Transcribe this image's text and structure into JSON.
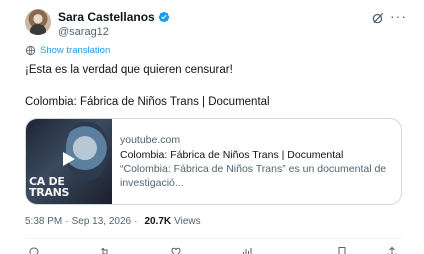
{
  "author": {
    "display_name": "Sara Castellanos",
    "handle": "@sarag12",
    "verified_color": "#1d9bf0"
  },
  "header_icons": [
    "grok-icon",
    "more-icon"
  ],
  "more_glyph": "···",
  "translate": {
    "label": "Show translation",
    "icon": "globe-icon"
  },
  "tweet": {
    "line1": "¡Esta es la verdad que quieren censurar!",
    "line2": "Colombia: Fábrica de Niños Trans | Documental"
  },
  "card": {
    "thumbnail_title": "CA DE TRANS",
    "thumbnail_title_line1": "CA DE",
    "thumbnail_title_line2": "TRANS",
    "domain": "youtube.com",
    "title": "Colombia: Fábrica de Niños Trans | Documental",
    "description": "“Colombia: Fábrica de Niños Trans” es un documental de investigació..."
  },
  "meta": {
    "time": "5:38 PM",
    "separator": "·",
    "date": "Sep 13, 2026",
    "views_count": "20.7K",
    "views_label": "Views"
  },
  "actions": [
    "reply-icon",
    "repost-icon",
    "like-icon",
    "stats-icon",
    "bookmark-icon",
    "share-icon"
  ],
  "colors": {
    "accent": "#1d9bf0",
    "text_primary": "#0f1419",
    "text_secondary": "#536471",
    "border": "#cfd9de"
  }
}
